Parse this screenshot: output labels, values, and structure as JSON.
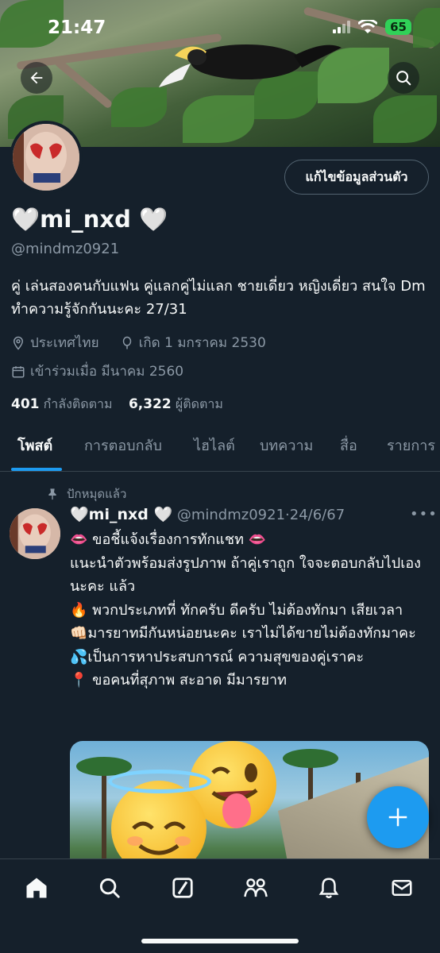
{
  "status_bar": {
    "time": "21:47",
    "battery": "65"
  },
  "profile": {
    "display_name": "🤍mi_nxd 🤍",
    "handle": "@mindmz0921",
    "edit_button": "แก้ไขข้อมูลส่วนตัว",
    "bio": "คู่ เล่นสองคนกับแฟน คู่แลกคู่ไม่แลก ชายเดี่ยว หญิงเดี่ยว สนใจ Dm ทำความรู้จักกันนะคะ 27/31",
    "location": "ประเทศไทย",
    "birthday": "เกิด 1 มกราคม 2530",
    "joined": "เข้าร่วมเมื่อ มีนาคม 2560",
    "following_count": "401",
    "following_label": "กำลังติดตาม",
    "followers_count": "6,322",
    "followers_label": "ผู้ติดตาม"
  },
  "tabs": [
    "โพสต์",
    "การตอบกลับ",
    "ไฮไลต์",
    "บทความ",
    "สื่อ",
    "รายการ"
  ],
  "pinned_post": {
    "pinned_label": "ปักหมุดแล้ว",
    "author": "🤍mi_nxd 🤍",
    "handle": "@mindmz0921",
    "separator": "·",
    "date": "24/6/67",
    "lines": [
      "👄 ขอชี้แจ้งเรื่องการทักแชท 👄",
      "แนะนำตัวพร้อมส่งรูปภาพ ถ้าคู่เราถูก ใจจะตอบกลับไปเองนะคะ แล้ว",
      "🔥 พวกประเภทที่ ทักครับ ดีครับ ไม่ต้องทักมา เสียเวลา",
      "👊🏻มารยาทมีกันหน่อยนะคะ เราไม่ได้ขายไม่ต้องทักมาคะ",
      "💦เป็นการหาประสบการณ์ ความสุขของคู่เราคะ",
      "📍 ขอคนที่สุภาพ สะอาด มีมารยาท"
    ]
  },
  "colors": {
    "background": "#15202b",
    "accent": "#1d9bf0",
    "muted": "#8b98a5",
    "border": "#38444d"
  },
  "icons": [
    "back-arrow-icon",
    "search-icon",
    "location-pin-icon",
    "balloon-icon",
    "calendar-icon",
    "pin-icon",
    "plus-icon",
    "home-icon",
    "grok-icon",
    "communities-icon",
    "bell-icon",
    "mail-icon"
  ]
}
